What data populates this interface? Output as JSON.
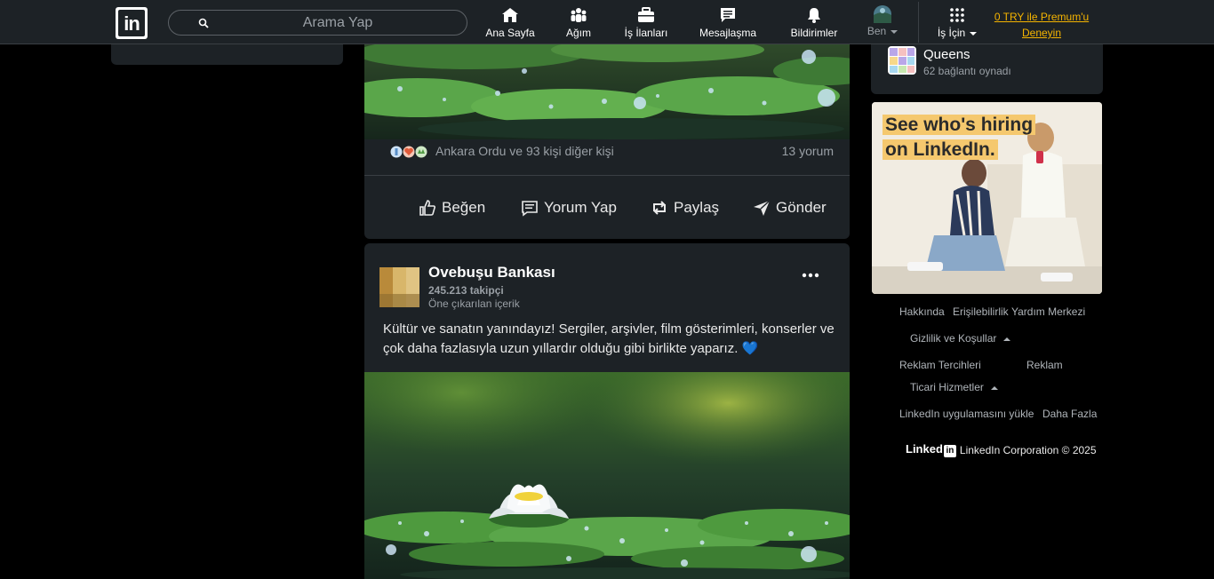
{
  "nav": {
    "logo": "in",
    "search_placeholder": "Arama Yap",
    "items": [
      {
        "label": "Ana Sayfa",
        "icon": "home-icon"
      },
      {
        "label": "Ağım",
        "icon": "network-icon"
      },
      {
        "label": "İş İlanları",
        "icon": "jobs-icon"
      },
      {
        "label": "Mesajlaşma",
        "icon": "messaging-icon"
      },
      {
        "label": "Bildirimler",
        "icon": "notifications-icon"
      },
      {
        "label": "Ben",
        "icon": "avatar-icon"
      },
      {
        "label": "İş İçin",
        "icon": "grid-icon"
      }
    ],
    "premium_line1": "0 TRY ile Premum'u",
    "premium_line2": "Deneyin",
    "accent": "#f5b400"
  },
  "post1": {
    "reactions_text": "Ankara Ordu ve 93 kişi diğer kişi",
    "comments": "13 yorum",
    "actions": {
      "like": "Beğen",
      "comment": "Yorum Yap",
      "repost": "Paylaş",
      "send": "Gönder"
    }
  },
  "post2": {
    "author": "Ovebuşu Bankası",
    "followers": "245.213 takipçi",
    "sub": "Öne çıkarılan içerik",
    "text": "Kültür ve sanatın yanındayız! Sergiler, arşivler, film gösterimleri, konserler ve çok daha fazlasıyla uzun yıllardır olduğu gibi birlikte yaparız. 💙"
  },
  "right": {
    "game_name": "Queens",
    "game_sub": "62 bağlantı oynadı",
    "ad_line1": "See who's hiring",
    "ad_line2": "on LinkedIn."
  },
  "footer": {
    "links": {
      "about": "Hakkında",
      "accessibility": "Erişilebilirlik",
      "help": "Yardım Merkezi",
      "privacy": "Gizlilik ve Koşullar",
      "ad_prefs": "Reklam Tercihleri",
      "ads": "Reklam",
      "business": "Ticari Hizmetler",
      "app": "LinkedIn uygulamasını yükle",
      "more": "Daha Fazla"
    },
    "brand": "Linked",
    "brand_box": "in",
    "copyright": "LinkedIn Corporation © 2025"
  }
}
